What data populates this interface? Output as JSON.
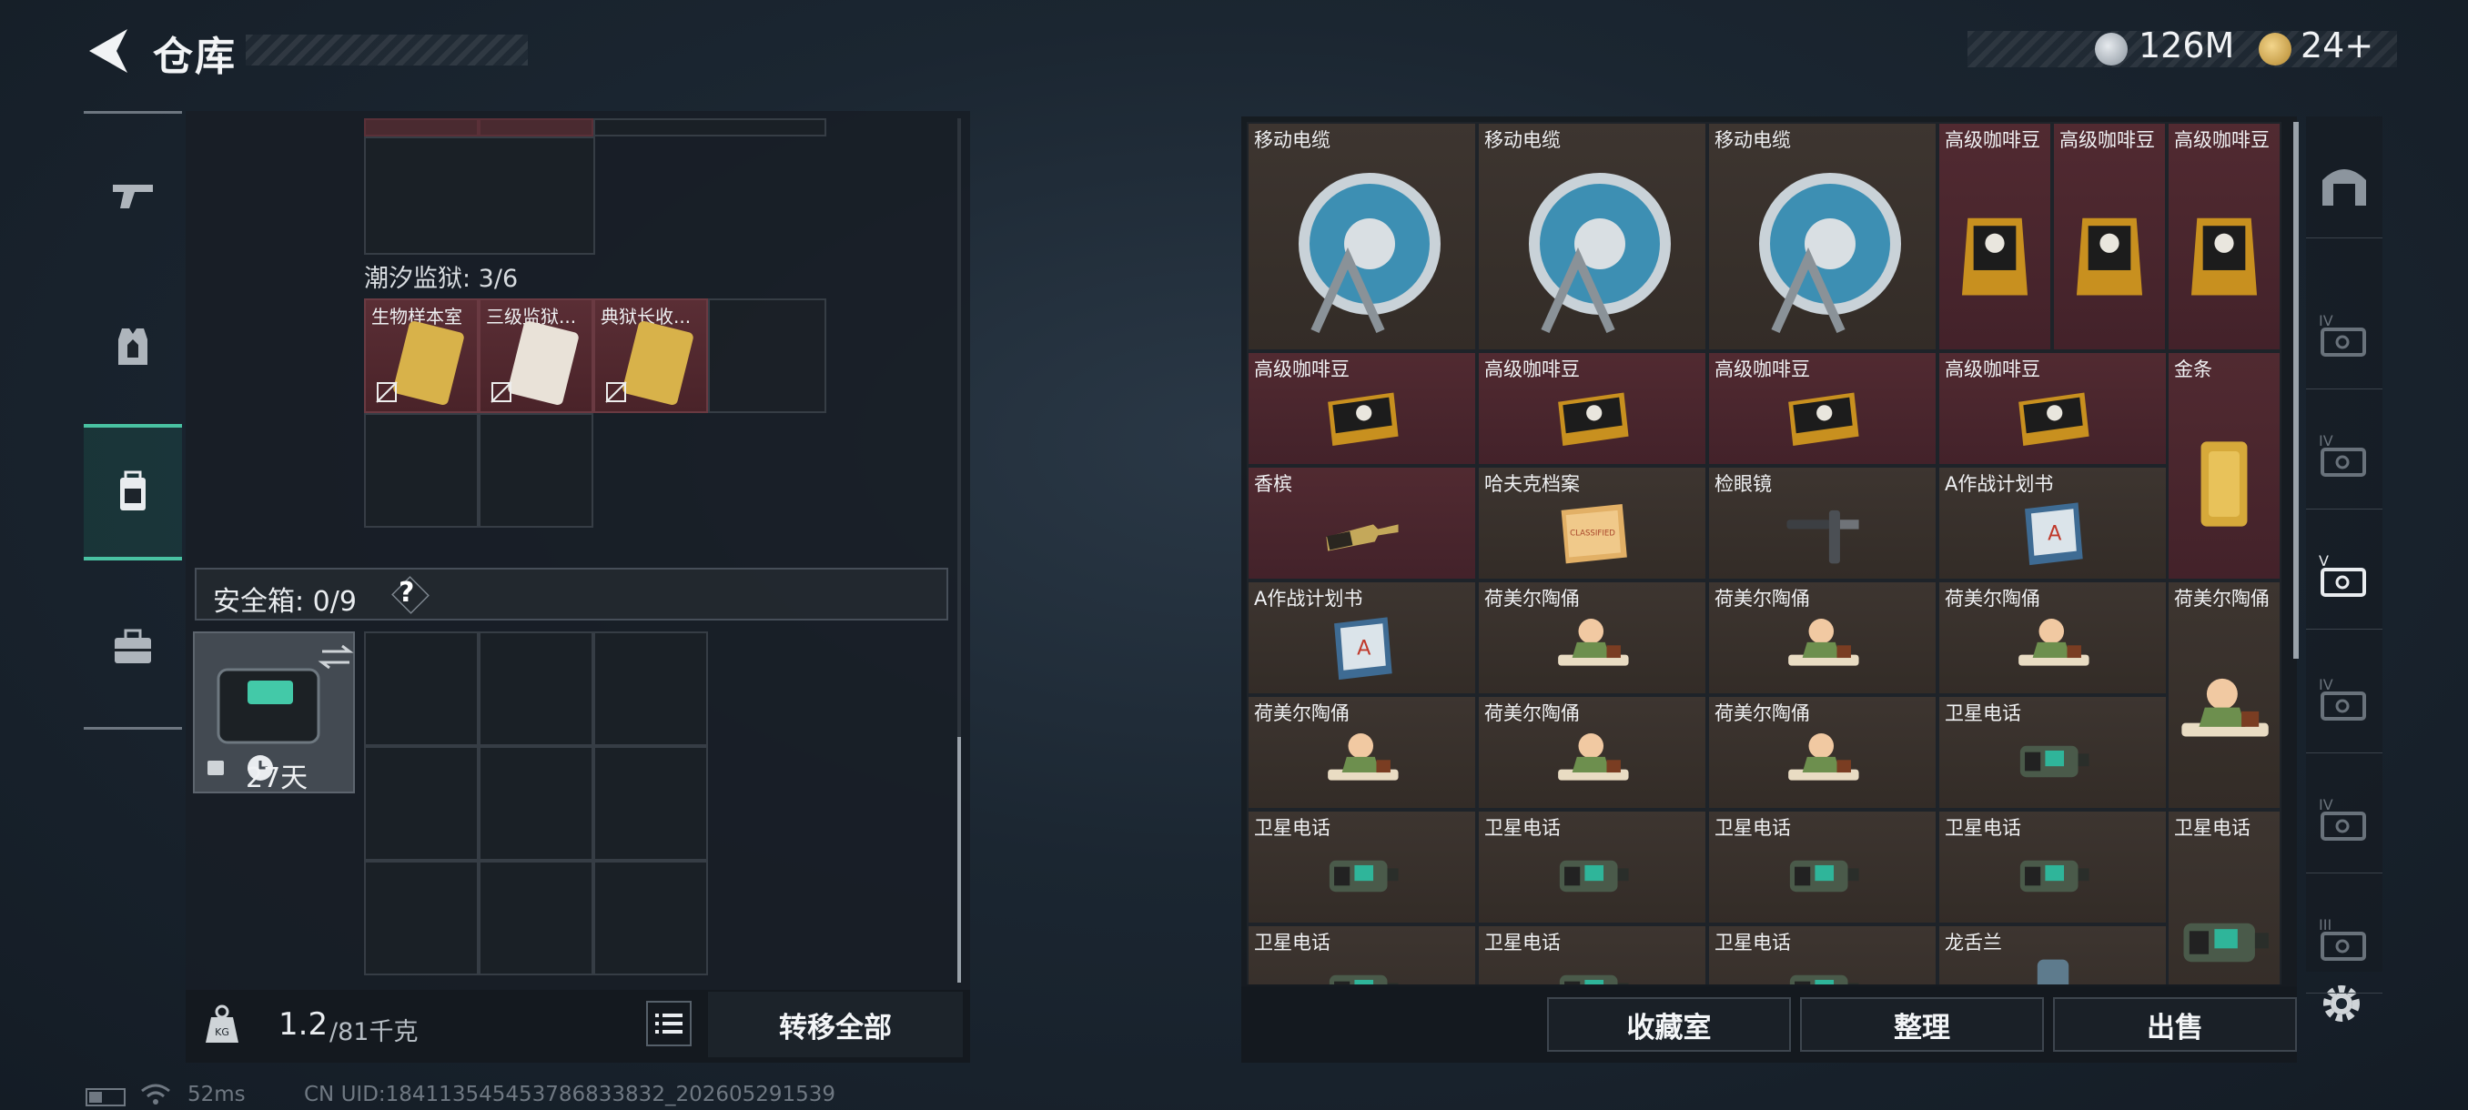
{
  "header": {
    "title": "仓库",
    "coins": "126M",
    "gems": "24+"
  },
  "left_nav": {
    "items": [
      "weapons",
      "armor",
      "backpack",
      "gear-case"
    ]
  },
  "backpack": {
    "prison_label": "潮汐监狱: 3/6",
    "keys": [
      {
        "name": "生物样本室",
        "color": "#d8b24a"
      },
      {
        "name": "三级监狱...",
        "color": "#e9e2d8"
      },
      {
        "name": "典狱长收...",
        "color": "#d8b24a"
      }
    ],
    "safebox_label": "安全箱: 0/9",
    "safebox_help": "?",
    "safebox_days": "27天",
    "weight_value": "1.2",
    "weight_unit": "/81千克",
    "transfer_all": "转移全部"
  },
  "stash": {
    "items": [
      {
        "name": "移动电缆",
        "art": "reel",
        "bg": "brown"
      },
      {
        "name": "移动电缆",
        "art": "reel",
        "bg": "brown"
      },
      {
        "name": "移动电缆",
        "art": "reel",
        "bg": "brown"
      },
      {
        "name": "高级咖啡豆",
        "art": "coffee-bag",
        "bg": "red"
      },
      {
        "name": "高级咖啡豆",
        "art": "coffee-bag",
        "bg": "red"
      },
      {
        "name": "高级咖啡豆",
        "art": "coffee-bag",
        "bg": "red"
      },
      {
        "name": "高级咖啡豆",
        "art": "coffee-flat",
        "bg": "red"
      },
      {
        "name": "高级咖啡豆",
        "art": "coffee-flat",
        "bg": "red"
      },
      {
        "name": "高级咖啡豆",
        "art": "coffee-flat",
        "bg": "red"
      },
      {
        "name": "高级咖啡豆",
        "art": "coffee-flat",
        "bg": "red"
      },
      {
        "name": "金条",
        "art": "gold",
        "bg": "red"
      },
      {
        "name": "香槟",
        "art": "champagne",
        "bg": "red"
      },
      {
        "name": "哈夫克档案",
        "art": "dossier",
        "bg": "brown"
      },
      {
        "name": "检眼镜",
        "art": "scope",
        "bg": "brown"
      },
      {
        "name": "A作战计划书",
        "art": "plan",
        "bg": "brown"
      },
      {
        "name": "A作战计划书",
        "art": "plan",
        "bg": "brown"
      },
      {
        "name": "荷美尔陶俑",
        "art": "figurine",
        "bg": "brown"
      },
      {
        "name": "荷美尔陶俑",
        "art": "figurine",
        "bg": "brown"
      },
      {
        "name": "荷美尔陶俑",
        "art": "figurine",
        "bg": "brown"
      },
      {
        "name": "荷美尔陶俑",
        "art": "figurine-tall",
        "bg": "brown"
      },
      {
        "name": "荷美尔陶俑",
        "art": "figurine",
        "bg": "brown"
      },
      {
        "name": "荷美尔陶俑",
        "art": "figurine",
        "bg": "brown"
      },
      {
        "name": "荷美尔陶俑",
        "art": "figurine",
        "bg": "brown"
      },
      {
        "name": "卫星电话",
        "art": "phone",
        "bg": "brown"
      },
      {
        "name": "卫星电话",
        "art": "phone",
        "bg": "brown"
      },
      {
        "name": "卫星电话",
        "art": "phone",
        "bg": "brown"
      },
      {
        "name": "卫星电话",
        "art": "phone",
        "bg": "brown"
      },
      {
        "name": "卫星电话",
        "art": "phone",
        "bg": "brown"
      },
      {
        "name": "卫星电话",
        "art": "phone-tall",
        "bg": "brown"
      },
      {
        "name": "卫星电话",
        "art": "phone",
        "bg": "brown"
      },
      {
        "name": "卫星电话",
        "art": "phone",
        "bg": "brown"
      },
      {
        "name": "卫星电话",
        "art": "phone",
        "bg": "brown"
      },
      {
        "name": "龙舌兰",
        "art": "bottle",
        "bg": "brown"
      }
    ],
    "footer": {
      "collection": "收藏室",
      "organize": "整理",
      "sell": "出售"
    }
  },
  "right_nav": {
    "tabs": [
      "building",
      "IV",
      "IV",
      "V",
      "IV",
      "IV",
      "III"
    ]
  },
  "status": {
    "ping": "52ms",
    "uid": "CN UID:18411354545378683383​2_202605291539"
  },
  "colors": {
    "accent": "#49c2a2",
    "key_bg": "#5a2e35",
    "item_red": "#512a31",
    "item_brown": "#3d3530"
  }
}
